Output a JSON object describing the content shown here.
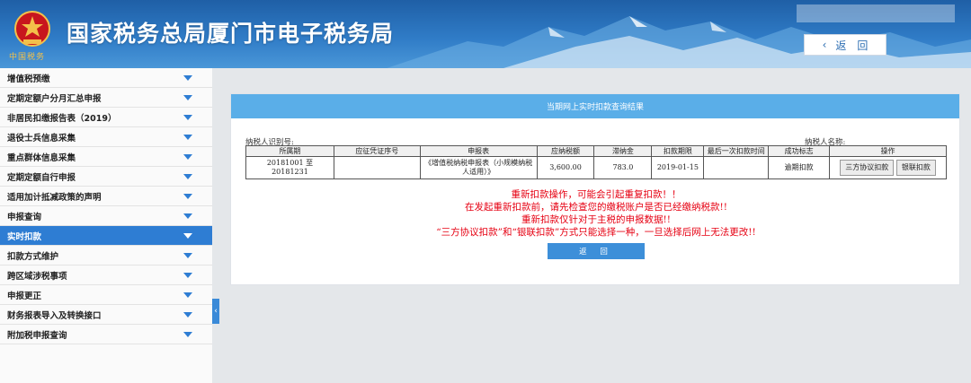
{
  "header": {
    "site_title": "国家税务总局厦门市电子税务局",
    "emblem_text": "中国税务",
    "back_label": "返　回",
    "back_arrow": "‹"
  },
  "sidebar": {
    "items": [
      {
        "label": "增值税预缴"
      },
      {
        "label": "定期定额户分月汇总申报"
      },
      {
        "label": "非居民扣缴报告表（2019）"
      },
      {
        "label": "退役士兵信息采集"
      },
      {
        "label": "重点群体信息采集"
      },
      {
        "label": "定期定额自行申报"
      },
      {
        "label": "适用加计抵减政策的声明"
      },
      {
        "label": "申报查询"
      },
      {
        "label": "实时扣款"
      },
      {
        "label": "扣款方式维护"
      },
      {
        "label": "跨区域涉税事项"
      },
      {
        "label": "申报更正"
      },
      {
        "label": "财务报表导入及转换接口"
      },
      {
        "label": "附加税申报查询"
      }
    ],
    "active_index": 8,
    "collapse_glyph": "‹"
  },
  "panel": {
    "title": "当期网上实时扣款查询结果",
    "taxpayer_id_label": "纳税人识别号:",
    "taxpayer_name_label": "纳税人名称:",
    "table": {
      "headers": [
        "所属期",
        "应征凭证序号",
        "申报表",
        "应纳税额",
        "滞纳金",
        "扣款期限",
        "最后一次扣款时间",
        "成功标志",
        "操作"
      ],
      "row": {
        "period": "20181001 至 20181231",
        "voucher": "",
        "form": "《增值税纳税申报表（小规模纳税人适用）》",
        "tax_due": "3,600.00",
        "late_fee": "783.0",
        "deadline": "2019-01-15",
        "last_time": "",
        "status": "逾期扣款",
        "btn_tripartite": "三方协议扣款",
        "btn_unionpay": "银联扣款"
      }
    },
    "warnings": [
      "重新扣款操作，可能会引起重复扣款！！",
      "在发起重新扣款前，请先检查您的缴税账户是否已经缴纳税款!!",
      "重新扣款仅针对于主税的申报数据!!",
      "“三方协议扣款”和“银联扣款”方式只能选择一种，一旦选择后网上无法更改!!"
    ],
    "return_label": "返 回"
  }
}
